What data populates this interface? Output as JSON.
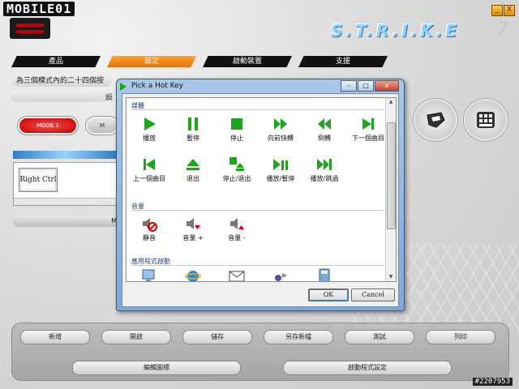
{
  "app": {
    "brand_logo_text": "MOBILE01",
    "title_logo": "S.T.R.I.K.E",
    "title_logo_suffix": "7",
    "window_min": "_",
    "window_close": "X"
  },
  "tabs": [
    {
      "label": "產品",
      "active": false
    },
    {
      "label": "設定",
      "active": true
    },
    {
      "label": "啟動裝置",
      "active": false
    },
    {
      "label": "支援",
      "active": false
    }
  ],
  "info": {
    "line1": "為三個模式內的二十四個按",
    "line2_right": "設"
  },
  "modes": {
    "mode1": "MODE 1",
    "mode2": "M"
  },
  "key_panel": {
    "key_label": "Right Ctrl"
  },
  "lower_strip": "M",
  "bottom_buttons_row1": [
    "新增",
    "開啟",
    "儲存",
    "另存新檔",
    "測試",
    "列印"
  ],
  "bottom_buttons_row2": [
    "編輯圖標",
    "啟動程式設定"
  ],
  "watermark": "#2207953",
  "dialog": {
    "title": "Pick a Hot Key",
    "minimize": "–",
    "maximize": "□",
    "close": "x",
    "groups": {
      "media": {
        "label": "媒體",
        "items": [
          {
            "label": "播放",
            "icon": "play-icon"
          },
          {
            "label": "暫停",
            "icon": "pause-icon"
          },
          {
            "label": "停止",
            "icon": "stop-icon"
          },
          {
            "label": "向前快轉",
            "icon": "fast-forward-icon"
          },
          {
            "label": "倒轉",
            "icon": "rewind-icon"
          },
          {
            "label": "下一個曲目",
            "icon": "next-track-icon"
          },
          {
            "label": "上一個曲目",
            "icon": "previous-track-icon"
          },
          {
            "label": "退出",
            "icon": "eject-icon"
          },
          {
            "label": "停止/退出",
            "icon": "stop-eject-icon"
          },
          {
            "label": "播放/暫停",
            "icon": "play-pause-icon"
          },
          {
            "label": "播放/跳過",
            "icon": "play-skip-icon"
          }
        ]
      },
      "volume": {
        "label": "音量",
        "items": [
          {
            "label": "靜音",
            "icon": "mute-icon"
          },
          {
            "label": "音量 +",
            "icon": "volume-up-icon"
          },
          {
            "label": "音量 -",
            "icon": "volume-down-icon"
          }
        ]
      },
      "apps": {
        "label": "應用程式啟動",
        "items": [
          {
            "icon": "computer-icon"
          },
          {
            "icon": "browser-icon"
          },
          {
            "icon": "mail-icon"
          },
          {
            "icon": "media-player-icon"
          },
          {
            "icon": "calculator-icon"
          }
        ]
      }
    },
    "ok_label": "OK",
    "cancel_label": "Cancel"
  },
  "colors": {
    "accent_orange": "#f08a1c",
    "mode_red": "#c00000",
    "media_green": "#1da51d",
    "dialog_frame": "#8fb3dc"
  }
}
